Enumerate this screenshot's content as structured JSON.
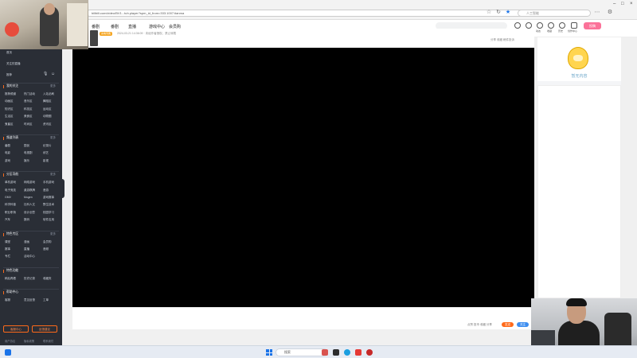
{
  "browser": {
    "url": "bilibili.com/video/BV1...tuh.player?spm_id_from=333.1007.tianma",
    "search_placeholder": "人工智能"
  },
  "site": {
    "nav": [
      "番剧",
      "番剧",
      "直播",
      "游戏中心",
      "会员购"
    ],
    "header_icons": [
      "大会员",
      "消息",
      "动态",
      "收藏",
      "历史",
      "创作中心"
    ],
    "upload_label": "投稿",
    "info_tag": "充电专属",
    "info_text": "2024-03-21 14:36:09  ·  未经作者授权，禁止转载",
    "info_right": "分享  收藏  稿件投诉",
    "actions": "点赞  投币  收藏  分享",
    "send_label": "发送",
    "like_label": "关注"
  },
  "right_panel": {
    "mascot_caption": "暂无内容"
  },
  "sidebar": {
    "top_items": [
      "首页",
      "关注的直播",
      "推荐"
    ],
    "sections": [
      {
        "title": "我的关注",
        "more": "更多",
        "rows": [
          [
            "推荐频道",
            "热门活动",
            "入站必刷"
          ],
          [
            "动画区",
            "音乐区",
            "舞蹈区"
          ],
          [
            "知识区",
            "科技区",
            "运动区"
          ],
          [
            "生活区",
            "美食区",
            "动物圈"
          ],
          [
            "鬼畜区",
            "时尚区",
            "资讯区"
          ]
        ]
      },
      {
        "title": "频道列表",
        "more": "更多",
        "rows": [
          [
            "番剧",
            "国创",
            "纪录片"
          ],
          [
            "电影",
            "电视剧",
            "综艺"
          ],
          [
            "游戏",
            "娱乐",
            "影视"
          ]
        ]
      },
      {
        "title": "分区导航",
        "more": "更多",
        "rows": [
          [
            "单机游戏",
            "网络游戏",
            "手机游戏"
          ],
          [
            "电子竞技",
            "桌游棋牌",
            "音游"
          ],
          [
            "GMV",
            "Mugen",
            "游戏赛事"
          ],
          [
            "科学科普",
            "社科人文",
            "野生技术"
          ],
          [
            "职业职场",
            "设计创意",
            "校园学习"
          ],
          [
            "汽车",
            "数码",
            "软件应用"
          ]
        ]
      },
      {
        "title": "特色专区",
        "more": "更多",
        "rows": [
          [
            "课堂",
            "漫画",
            "会员购"
          ],
          [
            "赛事",
            "直播",
            "音频"
          ],
          [
            "专栏",
            "活动中心",
            ""
          ]
        ]
      },
      {
        "title": "特色功能",
        "more": "",
        "rows": [
          [
            "稍后再看",
            "历史记录",
            "收藏夹"
          ]
        ]
      },
      {
        "title": "帮助中心",
        "more": "",
        "rows": [
          [
            "客服",
            "意见反馈",
            "工单"
          ]
        ]
      }
    ],
    "btn1": "客服中心",
    "btn2": "反馈建议",
    "footer": [
      "用户协议",
      "隐私政策",
      "联系我们"
    ]
  },
  "taskbar": {
    "search_placeholder": "搜索"
  },
  "colors": {
    "accent": "#fb7299",
    "orange": "#ff6a1a",
    "blue": "#3d8ef0",
    "sidebar_bg": "#2a2e36"
  }
}
